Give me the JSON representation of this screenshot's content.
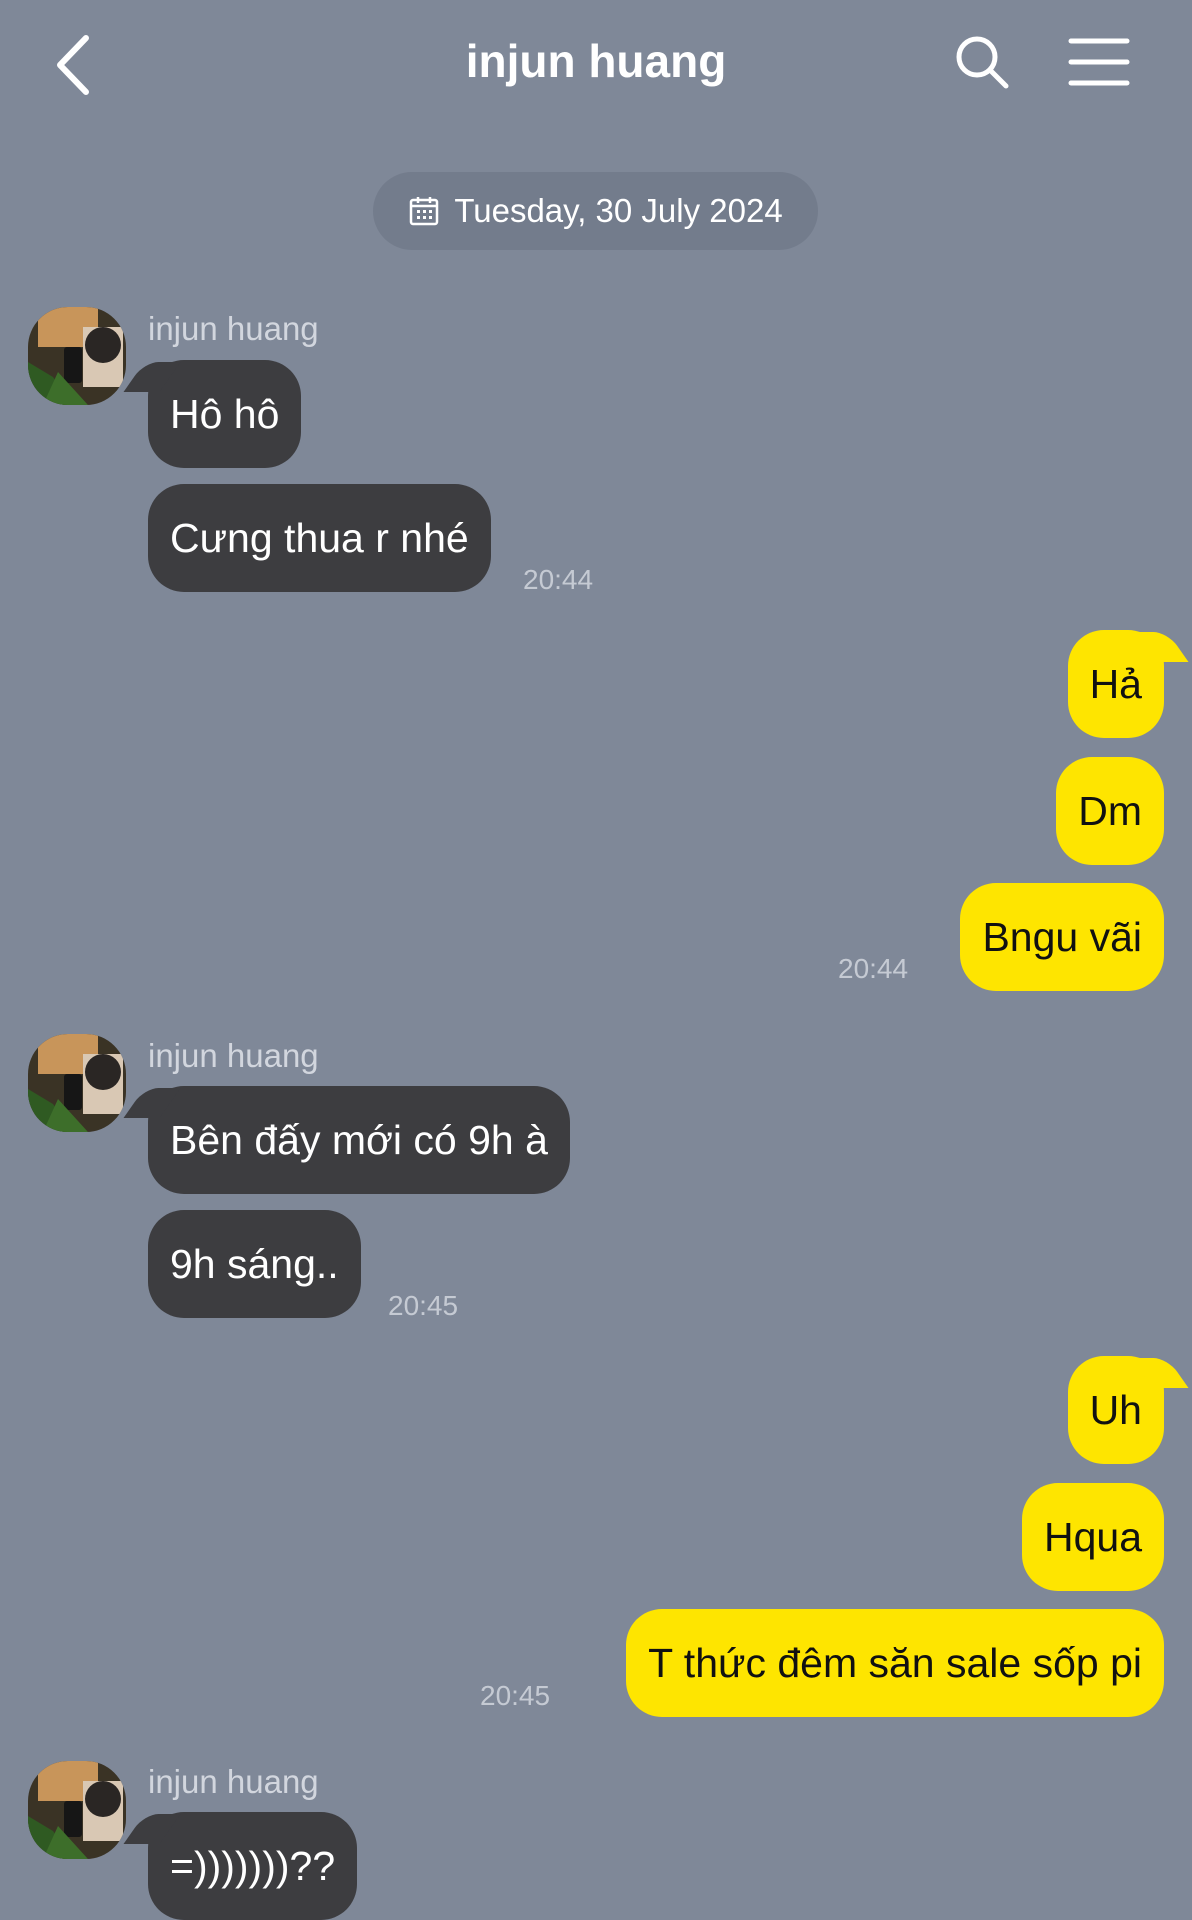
{
  "header": {
    "title": "injun huang"
  },
  "date_divider": {
    "label": "Tuesday, 30 July 2024"
  },
  "messages": {
    "g1": {
      "sender": "injun huang",
      "m1": "Hô hô",
      "m2": "Cưng thua r nhé",
      "time": "20:44"
    },
    "g2": {
      "m1": "Hả",
      "m2": "Dm",
      "m3": "Bngu vãi",
      "time": "20:44"
    },
    "g3": {
      "sender": "injun huang",
      "m1": "Bên đấy mới có 9h à",
      "m2": "9h sáng..",
      "time": "20:45"
    },
    "g4": {
      "m1": "Uh",
      "m2": "Hqua",
      "m3": "T thức đêm săn sale sốp pi",
      "time": "20:45"
    },
    "g5": {
      "sender": "injun huang",
      "m1": "=)))))))??"
    }
  },
  "colors": {
    "background": "#7f8898",
    "incoming_bubble": "#3d3d40",
    "outgoing_bubble": "#fee500"
  }
}
